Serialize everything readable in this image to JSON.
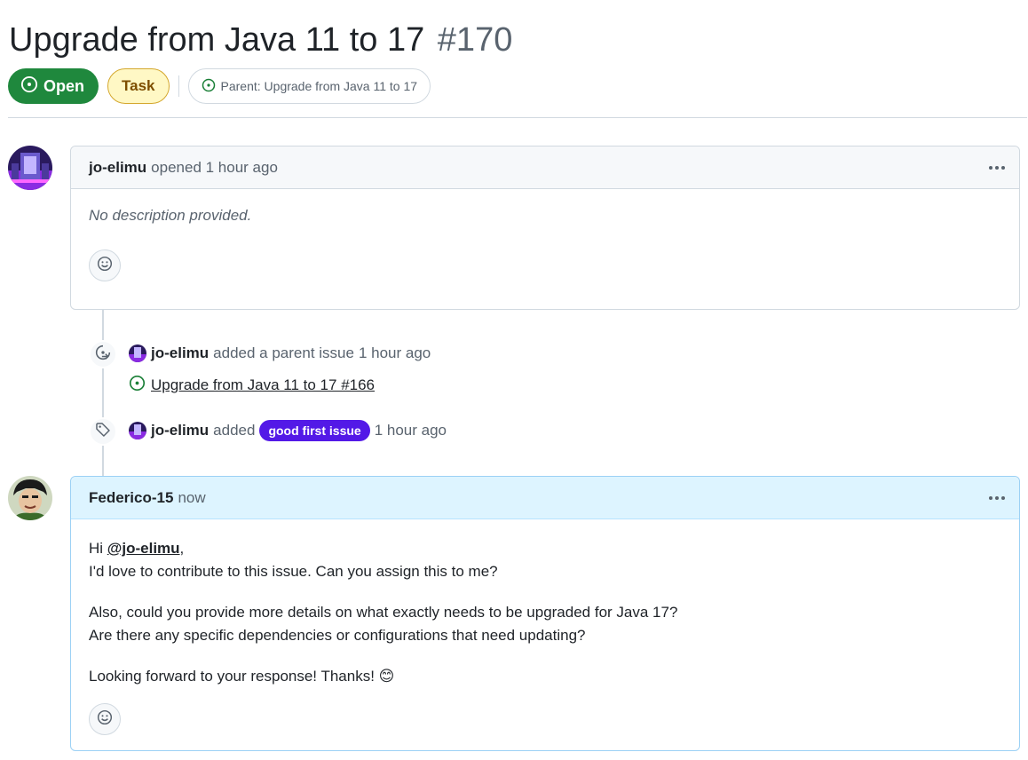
{
  "issue": {
    "title": "Upgrade from Java 11 to 17",
    "number": "#170",
    "state": "Open",
    "type": "Task",
    "parent_label": "Parent: Upgrade from Java 11 to 17"
  },
  "opening_comment": {
    "author": "jo-elimu",
    "meta": "opened 1 hour ago",
    "body": "No description provided."
  },
  "events": [
    {
      "actor": "jo-elimu",
      "action": "added a parent issue",
      "time": "1 hour ago",
      "linked_issue": "Upgrade from Java 11 to 17 #166"
    },
    {
      "actor": "jo-elimu",
      "action": "added",
      "label": "good first issue",
      "time": "1 hour ago"
    }
  ],
  "reply_comment": {
    "author": "Federico-15",
    "meta": "now",
    "greeting_prefix": "Hi",
    "mention": "@jo-elimu",
    "greeting_suffix": ",",
    "line1": "I'd love to contribute to this issue. Can you assign this to me?",
    "line2": "Also, could you provide more details on what exactly needs to be upgraded for Java 17?",
    "line3": "Are there any specific dependencies or configurations that need updating?",
    "line4": "Looking forward to your response! Thanks! 😊"
  },
  "colors": {
    "open_green": "#1f883d",
    "label_purple": "#5319e7",
    "task_yellow_bg": "#fff8c5",
    "highlight_header": "#ddf4ff"
  },
  "icons": [
    "issue-open-icon",
    "kebab-menu-icon",
    "smiley-icon",
    "sub-issue-icon",
    "tag-icon"
  ]
}
